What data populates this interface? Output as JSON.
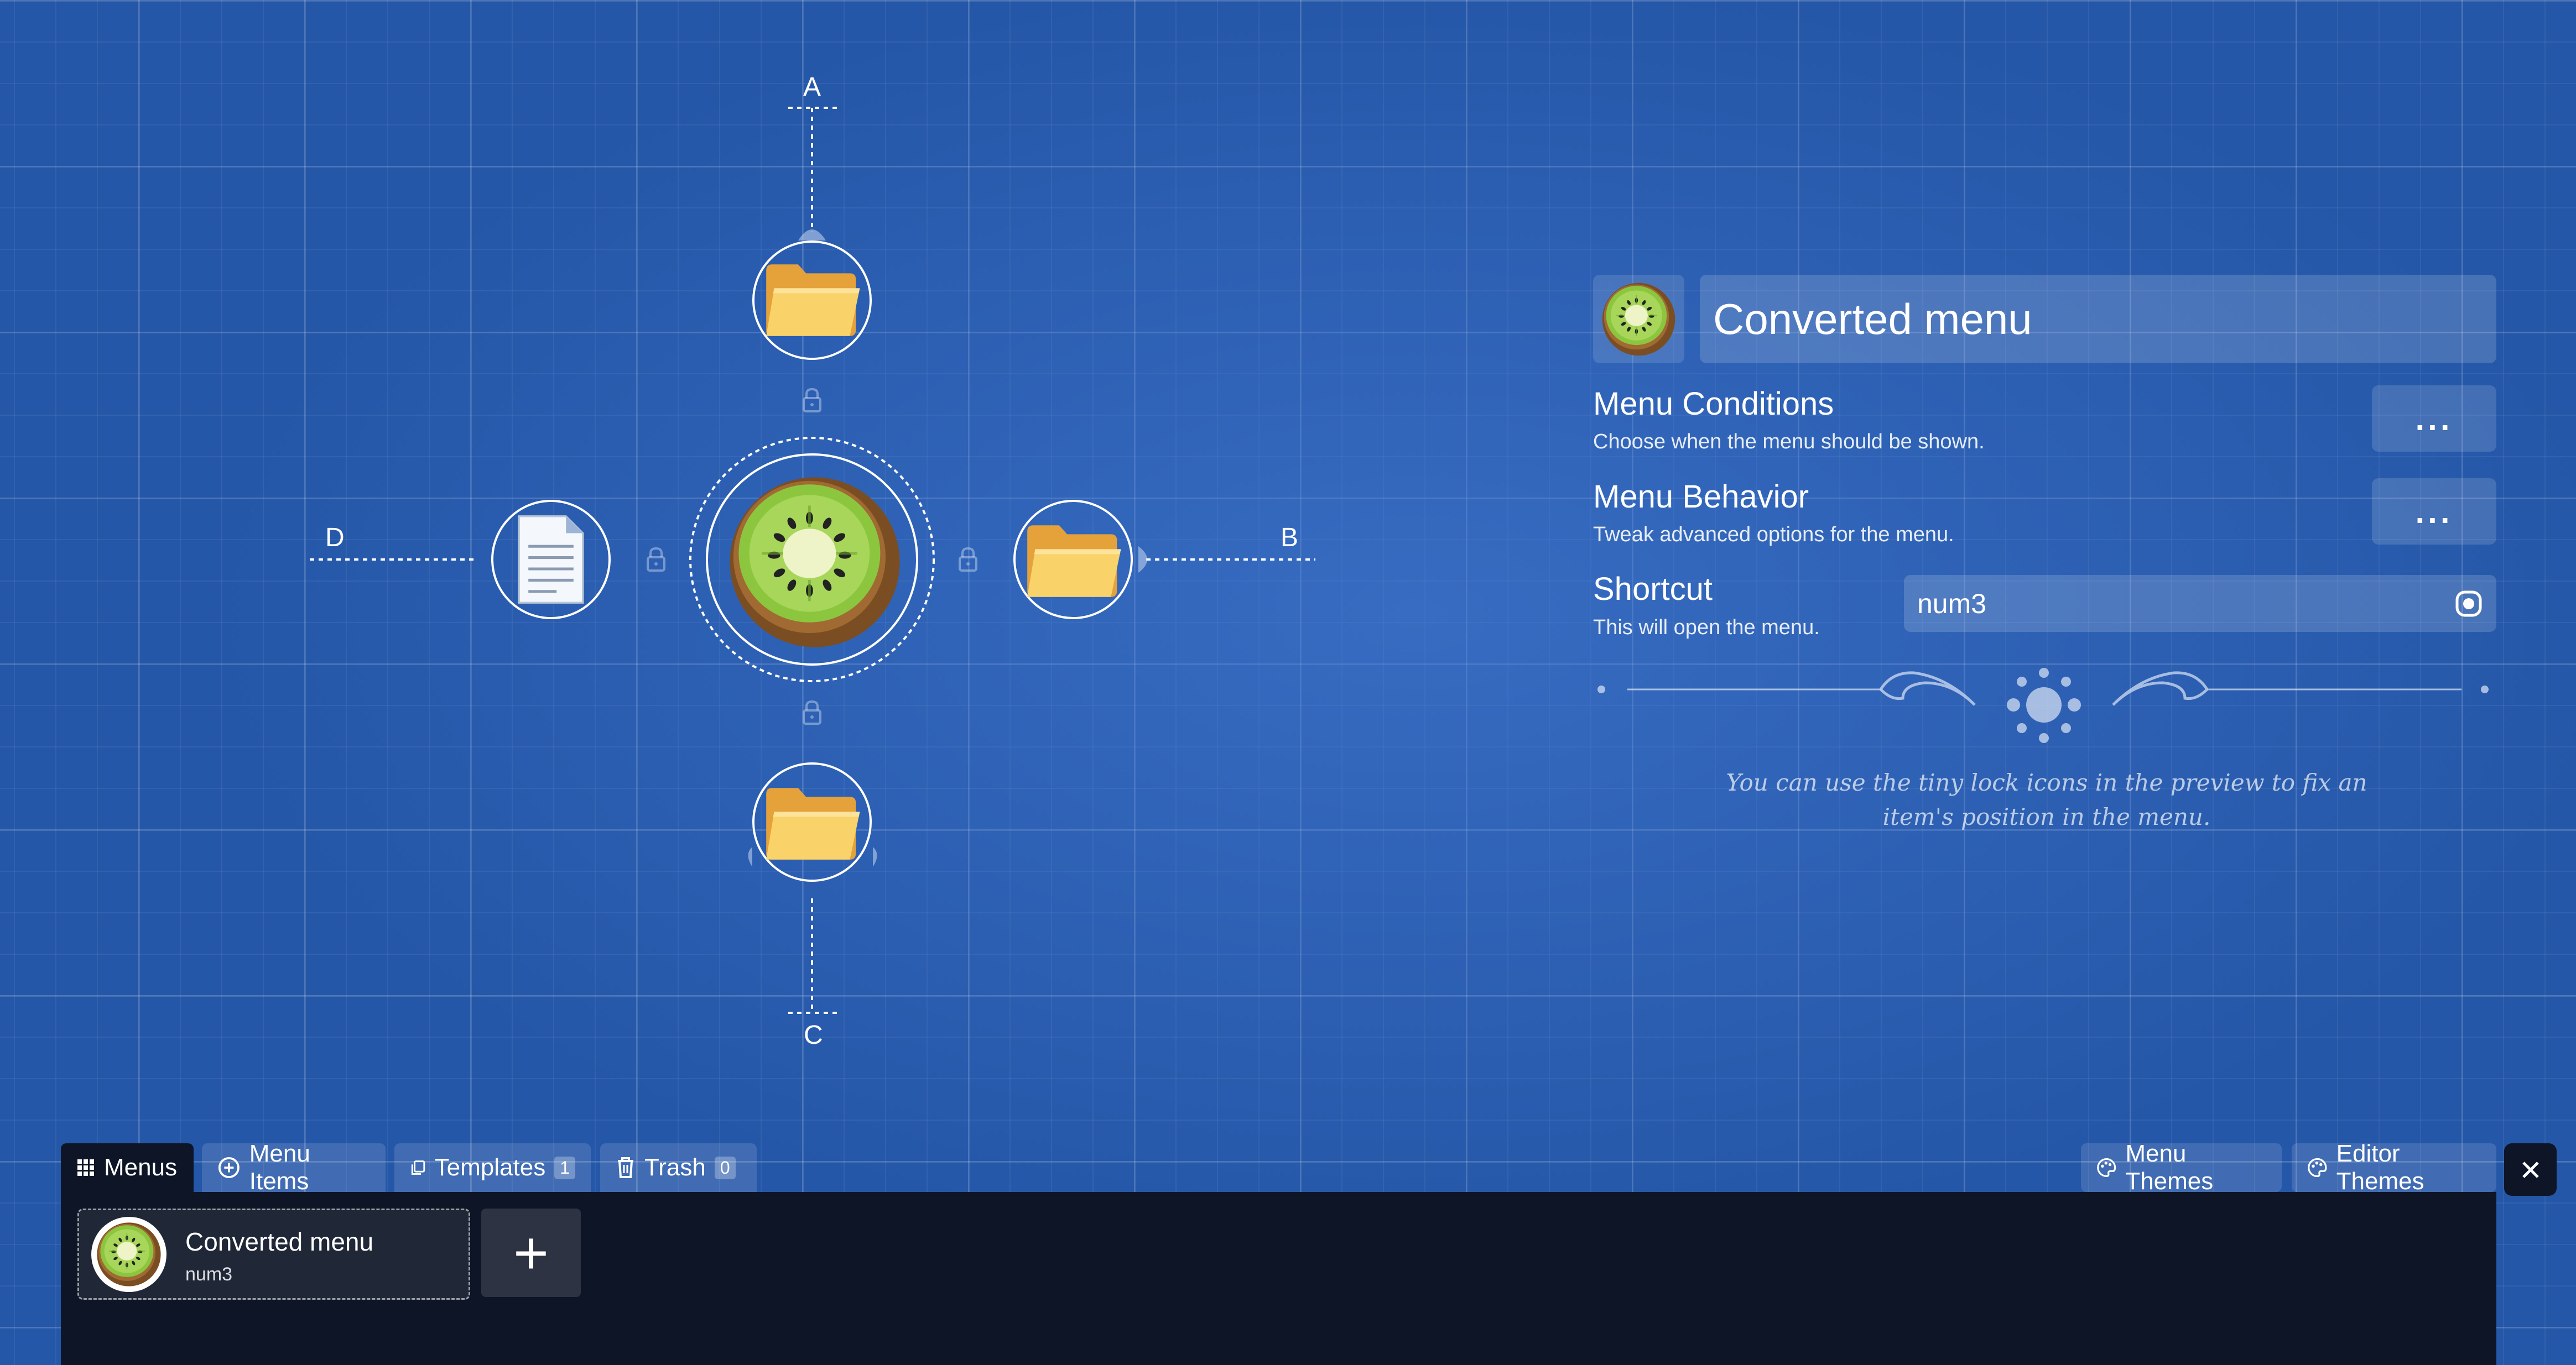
{
  "preview": {
    "slot_labels": [
      "A",
      "B",
      "C",
      "D"
    ],
    "center_icon": "kiwi-icon",
    "items": [
      {
        "position": "top",
        "icon": "folder-icon"
      },
      {
        "position": "right",
        "icon": "folder-icon"
      },
      {
        "position": "bottom",
        "icon": "folder-icon"
      },
      {
        "position": "left",
        "icon": "document-icon"
      }
    ]
  },
  "properties": {
    "menu_icon": "kiwi-icon",
    "menu_name": "Converted menu",
    "conditions": {
      "title": "Menu Conditions",
      "desc": "Choose when the menu should be shown.",
      "button": "..."
    },
    "behavior": {
      "title": "Menu Behavior",
      "desc": "Tweak advanced options for the menu.",
      "button": "..."
    },
    "shortcut": {
      "title": "Shortcut",
      "desc": "This will open the menu.",
      "value": "num3"
    },
    "hint": "You can use the tiny lock icons in the preview to fix an item's position in the menu."
  },
  "tabs": [
    {
      "label": "Menus",
      "icon": "grid-icon",
      "active": true
    },
    {
      "label": "Menu Items",
      "icon": "add-circle-icon"
    },
    {
      "label": "Templates",
      "icon": "copy-icon",
      "count": "1"
    },
    {
      "label": "Trash",
      "icon": "trash-icon",
      "count": "0"
    }
  ],
  "right_tabs": [
    {
      "label": "Menu Themes",
      "icon": "palette-icon"
    },
    {
      "label": "Editor Themes",
      "icon": "palette-icon"
    }
  ],
  "close_icon": "close-icon",
  "menus": [
    {
      "name": "Converted menu",
      "shortcut": "num3",
      "icon": "kiwi-icon"
    }
  ],
  "add_button": "+",
  "colors": {
    "background": "#2557a8",
    "drawer": "#0e1526",
    "folder": "#f2b441",
    "kiwi_green": "#8cc63f"
  }
}
